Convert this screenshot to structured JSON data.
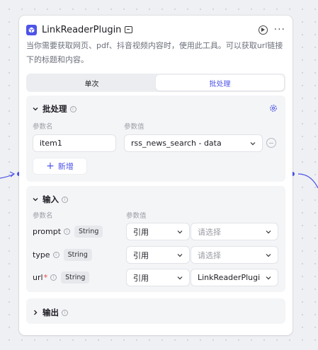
{
  "node": {
    "title": "LinkReaderPlugin",
    "description": "当你需要获取网页、pdf、抖音视频内容时，使用此工具。可以获取url链接下的标题和内容。",
    "icons": [
      "plugin-logo-icon",
      "book-icon",
      "play-circle-icon",
      "more-icon"
    ]
  },
  "tabs": [
    {
      "label": "单次",
      "active": false
    },
    {
      "label": "批处理",
      "active": true
    }
  ],
  "batch": {
    "title": "批处理",
    "col_name": "参数名",
    "col_value": "参数值",
    "rows": [
      {
        "name": "item1",
        "value": "rss_news_search - data"
      }
    ],
    "add_label": "新增"
  },
  "input": {
    "title": "输入",
    "col_name": "参数名",
    "col_value": "参数值",
    "params": [
      {
        "name": "prompt",
        "required": false,
        "type": "String",
        "mode": "引用",
        "value": "请选择",
        "is_placeholder": true
      },
      {
        "name": "type",
        "required": false,
        "type": "String",
        "mode": "引用",
        "value": "请选择",
        "is_placeholder": true
      },
      {
        "name": "url",
        "required": true,
        "type": "String",
        "mode": "引用",
        "value": "LinkReaderPlugi",
        "is_placeholder": false
      }
    ]
  },
  "output": {
    "title": "输出"
  },
  "colors": {
    "accent": "#4d53e8",
    "section_bg": "#f4f5f7",
    "connector": "#4d53e8",
    "required": "#e54545"
  }
}
